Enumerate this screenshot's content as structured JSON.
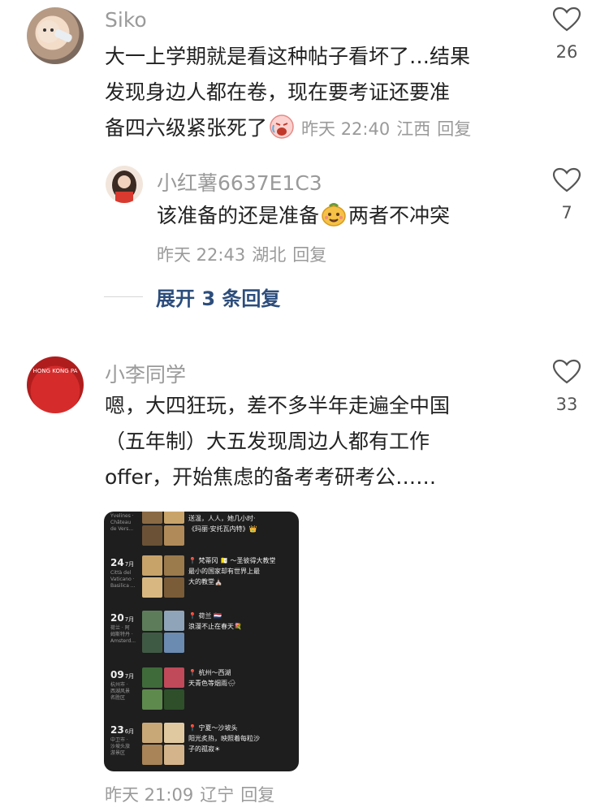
{
  "comments": [
    {
      "author": "Siko",
      "text_lines": [
        "大一上学期就是看这种帖子看坏了…结果",
        "发现身边人都在卷，现在要考证还要准",
        "备四六级紧张死了"
      ],
      "time": "昨天 22:40",
      "location": "江西",
      "reply_label": "回复",
      "likes": "26",
      "emoji": "crying-emoji"
    },
    {
      "author": "小李同学",
      "text_lines": [
        "嗯，大四狂玩，差不多半年走遍全中国",
        "（五年制）大五发现周边人都有工作",
        "offer，开始焦虑的备考考研考公……"
      ],
      "time": "昨天 21:09",
      "location": "辽宁",
      "reply_label": "回复",
      "likes": "33",
      "avatar_text": "HONG KONG PA"
    }
  ],
  "reply": {
    "author": "小红薯6637E1C3",
    "text_before": "该准备的还是准备",
    "text_after": "两者不冲突",
    "emoji": "smiling-bun-emoji",
    "time": "昨天 22:43",
    "location": "湖北",
    "reply_label": "回复",
    "likes": "7"
  },
  "expand_label": "展开 3 条回复",
  "timeline": [
    {
      "day": "",
      "month": "",
      "place": [
        "Yvelines ·",
        "Château",
        "de Vers..."
      ],
      "caption": [
        "送温，人人，她几小时·",
        "《玛丽·安托瓦内特》👑"
      ]
    },
    {
      "day": "24",
      "month": "7月",
      "place": [
        "Città del",
        "Vaticano ·",
        "Basilica ..."
      ],
      "caption": [
        "📍 梵蒂冈 🇻🇦 ～圣彼得大教堂",
        "最小的国家却有世界上最",
        "大的教堂⛪"
      ]
    },
    {
      "day": "20",
      "month": "7月",
      "place": [
        "荷兰 · 阿",
        "姆斯特丹 ·",
        "Amsterd..."
      ],
      "caption": [
        "📍 荷兰 🇳🇱",
        "浪漫不止在春天💐"
      ]
    },
    {
      "day": "09",
      "month": "7月",
      "place": [
        "杭州市 ·",
        "西湖风景",
        "名胜区"
      ],
      "caption": [
        "📍 杭州～西湖",
        "天青色等烟雨🌧"
      ]
    },
    {
      "day": "23",
      "month": "6月",
      "place": [
        "中卫市 ·",
        "沙坡头旅",
        "游景区"
      ],
      "caption": [
        "📍 宁夏～沙坡头",
        "阳光炙热，映照着每粒沙",
        "子的孤寂☀"
      ]
    }
  ],
  "colors": {
    "text_primary": "#222222",
    "text_secondary": "#9a9a9a",
    "link": "#2c4d7c",
    "screenshot_bg": "#1e1e1e"
  }
}
